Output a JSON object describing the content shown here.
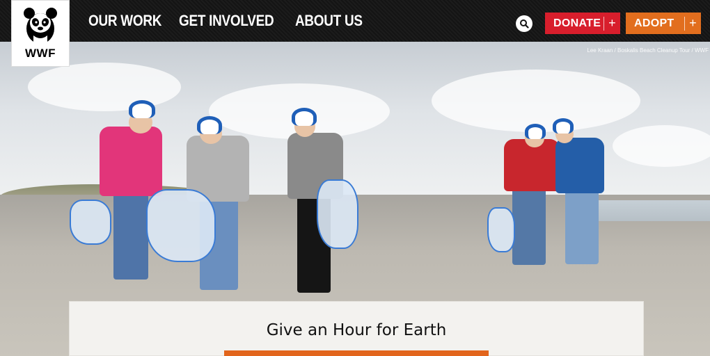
{
  "header": {
    "logo_text": "WWF",
    "nav": [
      "OUR WORK",
      "GET INVOLVED",
      "ABOUT US"
    ],
    "donate_label": "DONATE",
    "adopt_label": "ADOPT",
    "plus_glyph": "+",
    "accent_donate": "#d81e2c",
    "accent_adopt": "#e26e1e"
  },
  "hero": {
    "photo_credit": "Lee Kraan / Boskalis Beach Cleanup Tour / WWF"
  },
  "card": {
    "title": "Give an Hour for Earth"
  },
  "icons": [
    "panda-logo",
    "search-icon",
    "plus-icon"
  ]
}
